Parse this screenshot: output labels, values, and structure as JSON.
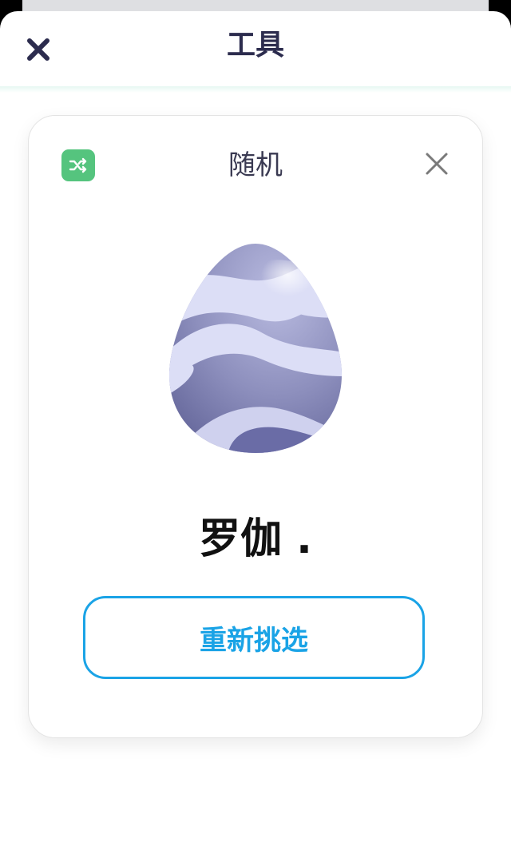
{
  "sheet": {
    "title": "工具",
    "close_icon": "close-icon"
  },
  "card": {
    "title": "随机",
    "tool_icon": "shuffle-icon",
    "close_icon": "close-icon",
    "image": "egg-icon",
    "result": "罗伽 .",
    "reselect_label": "重新挑选"
  },
  "colors": {
    "title_text": "#2c2c4e",
    "accent_green": "#55c47e",
    "button_blue": "#1aa3e6",
    "egg_body": "#8d8fbd",
    "egg_stripe": "#dcdef6"
  }
}
